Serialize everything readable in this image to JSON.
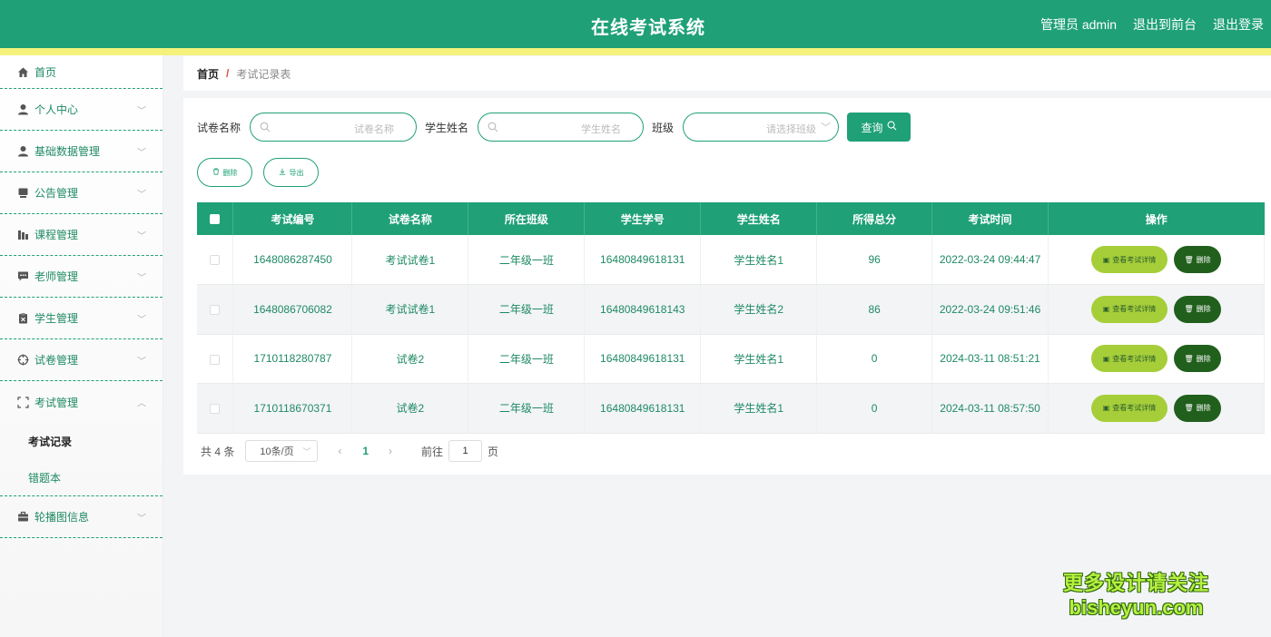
{
  "header": {
    "title": "在线考试系统",
    "links": [
      "管理员 admin",
      "退出到前台",
      "退出登录"
    ]
  },
  "sidebar": {
    "items": [
      {
        "label": "首页",
        "icon": "home-icon"
      },
      {
        "label": "个人中心",
        "icon": "user-icon"
      },
      {
        "label": "基础数据管理",
        "icon": "user-icon"
      },
      {
        "label": "公告管理",
        "icon": "monitor-icon"
      },
      {
        "label": "课程管理",
        "icon": "chart-icon"
      },
      {
        "label": "老师管理",
        "icon": "chat-icon"
      },
      {
        "label": "学生管理",
        "icon": "clipboard-icon"
      },
      {
        "label": "试卷管理",
        "icon": "target-icon"
      },
      {
        "label": "考试管理",
        "icon": "fullscreen-icon"
      },
      {
        "label": "轮播图信息",
        "icon": "briefcase-icon"
      }
    ],
    "submenu": [
      "考试记录",
      "错题本"
    ]
  },
  "breadcrumb": {
    "home": "首页",
    "sep": "/",
    "current": "考试记录表"
  },
  "filters": {
    "paper_label": "试卷名称",
    "paper_placeholder": "试卷名称",
    "student_label": "学生姓名",
    "student_placeholder": "学生姓名",
    "class_label": "班级",
    "class_placeholder": "请选择班级",
    "query": "查询"
  },
  "actions": {
    "delete": "删除",
    "export": "导出"
  },
  "table": {
    "headers": [
      "考试编号",
      "试卷名称",
      "所在班级",
      "学生学号",
      "学生姓名",
      "所得总分",
      "考试时间",
      "操作"
    ],
    "rows": [
      [
        "1648086287450",
        "考试试卷1",
        "二年级一班",
        "16480849618131",
        "学生姓名1",
        "96",
        "2022-03-24 09:44:47"
      ],
      [
        "1648086706082",
        "考试试卷1",
        "二年级一班",
        "16480849618143",
        "学生姓名2",
        "86",
        "2022-03-24 09:51:46"
      ],
      [
        "1710118280787",
        "试卷2",
        "二年级一班",
        "16480849618131",
        "学生姓名1",
        "0",
        "2024-03-11 08:51:21"
      ],
      [
        "1710118670371",
        "试卷2",
        "二年级一班",
        "16480849618131",
        "学生姓名1",
        "0",
        "2024-03-11 08:57:50"
      ]
    ],
    "detail_btn": "查看考试详情",
    "delete_btn": "删除"
  },
  "pager": {
    "total": "共 4 条",
    "size": "10条/页",
    "current": "1",
    "goto": "前往",
    "page_input": "1",
    "page_unit": "页"
  },
  "watermark": {
    "line1": "更多设计请关注",
    "line2": "bisheyun.com"
  },
  "colors": {
    "primary": "#1fa077",
    "stripe": "#f4f27d",
    "detail": "#a6ce39",
    "delete": "#215f1d"
  }
}
